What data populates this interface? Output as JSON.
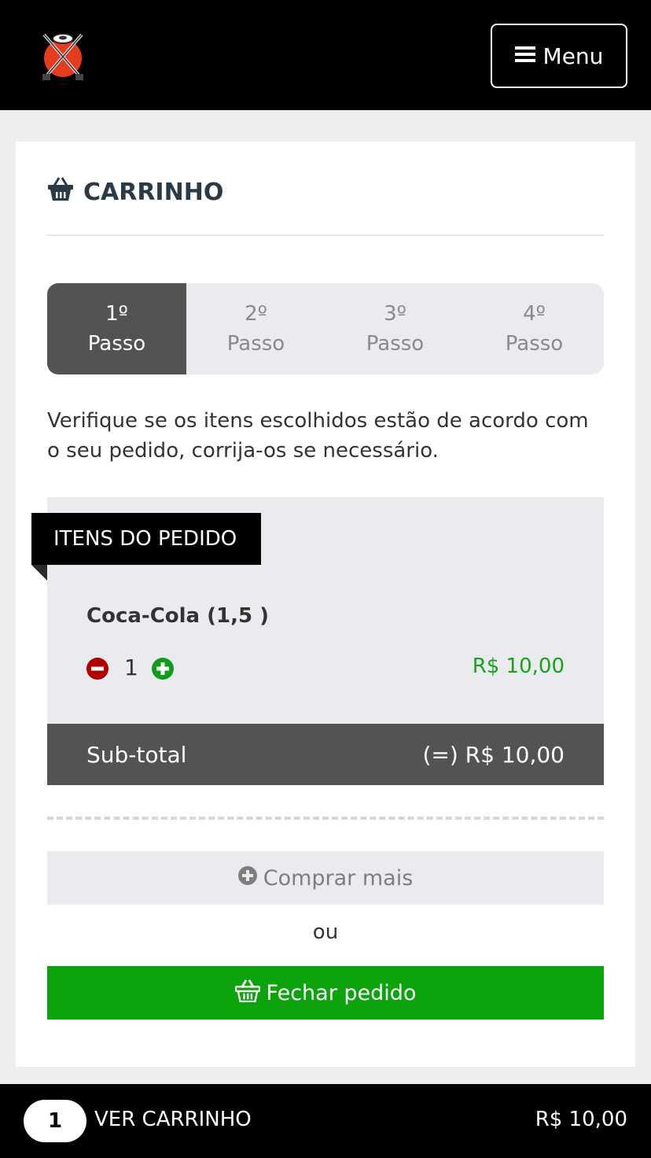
{
  "header": {
    "logo_icon": "samurai-swords-logo",
    "menu_label": "Menu",
    "menu_icon": "hamburger-icon"
  },
  "cart": {
    "title": "CARRINHO",
    "title_icon": "basket-icon",
    "steps": [
      {
        "number": "1º",
        "label": "Passo",
        "active": true
      },
      {
        "number": "2º",
        "label": "Passo",
        "active": false
      },
      {
        "number": "3º",
        "label": "Passo",
        "active": false
      },
      {
        "number": "4º",
        "label": "Passo",
        "active": false
      }
    ],
    "intro": "Verifique se os itens escolhidos estão de acordo com o seu pedido, corrija-os se necessário.",
    "items_heading": "ITENS DO PEDIDO",
    "items": [
      {
        "name": "Coca-Cola (1,5 )",
        "quantity": "1",
        "price": "R$ 10,00"
      }
    ],
    "subtotal_label": "Sub-total",
    "subtotal_value": "(=) R$ 10,00",
    "buy_more_label": "Comprar mais",
    "or_label": "ou",
    "close_order_label": "Fechar pedido"
  },
  "bottom_bar": {
    "count": "1",
    "view_cart_label": "VER CARRINHO",
    "total": "R$ 10,00"
  },
  "colors": {
    "header_bg": "#000000",
    "active_step": "#535353",
    "price_green": "#1aa31a",
    "close_button": "#0da30d",
    "minus_red": "#b00000",
    "plus_green": "#0e9c1a"
  }
}
